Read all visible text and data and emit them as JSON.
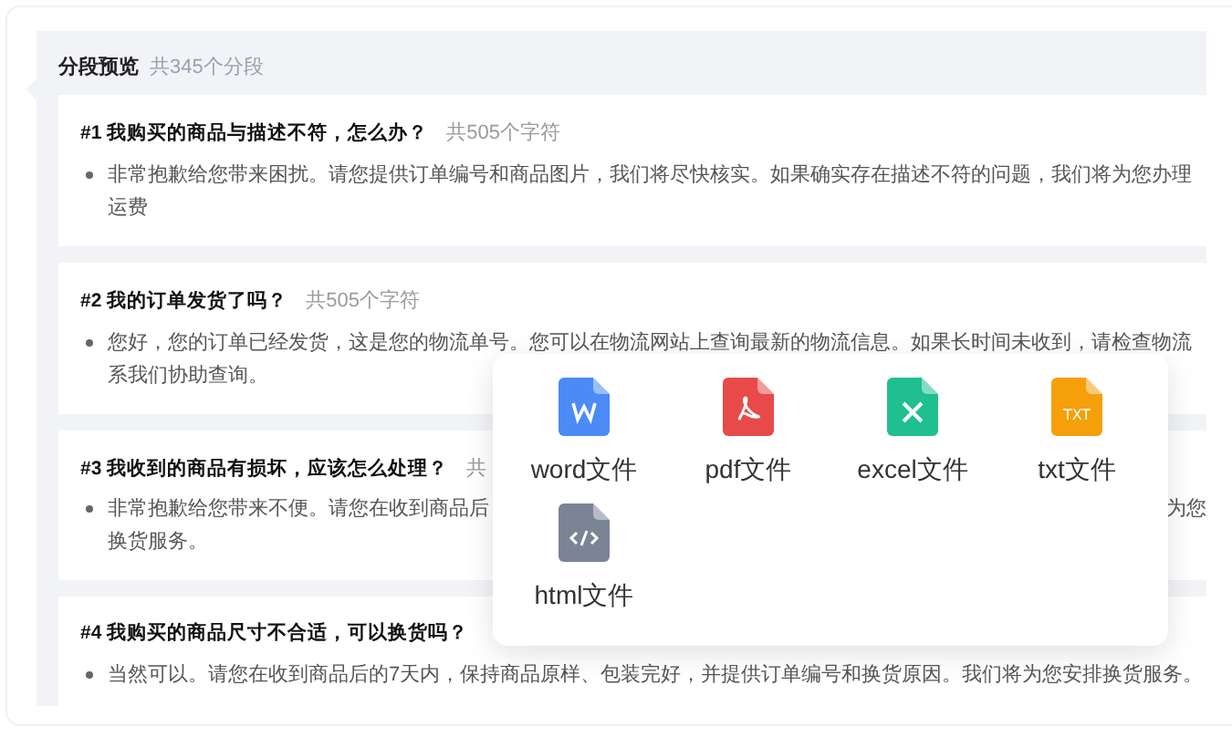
{
  "preview": {
    "title": "分段预览",
    "count": "共345个分段"
  },
  "segments": [
    {
      "title": "#1 我购买的商品与描述不符，怎么办？",
      "count": "共505个字符",
      "lines": [
        [
          "非常抱歉给您带来困扰。请您提供订单编号和商品图片，我们将尽快核实。如果确实存在描述不符的问题，我们将为您办理"
        ],
        [
          "运费"
        ]
      ]
    },
    {
      "title": "#2 我的订单发货了吗？",
      "count": "共505个字符",
      "lines": [
        [
          "您好，您的订单已经发货，这是您的物流单号。您可以在物流网站上查询最新的物流信息。如果长时间未收到，请检查物流"
        ],
        [
          "系我们协助查询。"
        ]
      ]
    },
    {
      "title": "#3 我收到的商品有损坏，应该怎么处理？",
      "count": "共",
      "lines": [
        [
          "非常抱歉给您带来不便。请您在收到商品后",
          "为您"
        ],
        [
          "换货服务。"
        ]
      ]
    },
    {
      "title": "#4 我购买的商品尺寸不合适，可以换货吗？",
      "lines": [
        [
          "当然可以。请您在收到商品后的7天内，保持商品原样、包装完好，并提供订单编号和换货原因。我们将为您安排换货服务。"
        ]
      ]
    }
  ],
  "export_menu": [
    {
      "kind": "word",
      "label": "word文件"
    },
    {
      "kind": "pdf",
      "label": "pdf文件"
    },
    {
      "kind": "excel",
      "label": "excel文件"
    },
    {
      "kind": "txt",
      "label": "txt文件",
      "icon_text": "TXT"
    },
    {
      "kind": "html",
      "label": "html文件"
    }
  ]
}
